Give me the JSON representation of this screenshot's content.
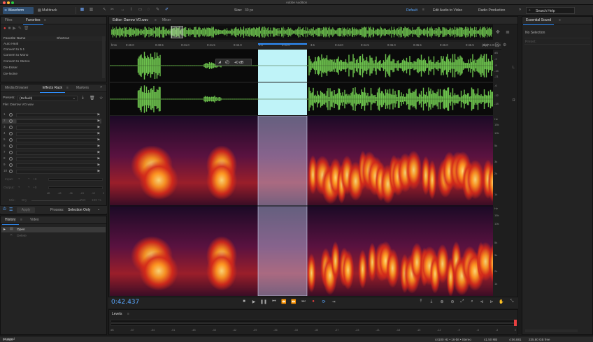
{
  "window": {
    "title": "Adobe Audition"
  },
  "toolbar": {
    "waveform": "Waveform",
    "multitrack": "Multitrack",
    "size_label": "Size:",
    "size_value": "30 px",
    "workspace_default": "Default",
    "workspace_edit_video": "Edit Audio to Video",
    "workspace_radio": "Radio Production",
    "search_placeholder": "Search Help"
  },
  "files_panel": {
    "tabs": [
      "Files",
      "Favorites"
    ],
    "columns": [
      "Favorite Name",
      "Shortcut"
    ],
    "items": [
      "Auto Heal",
      "Convert to 5.1",
      "Convert to Mono",
      "Convert to Stereo",
      "De-Esser",
      "De-Noise"
    ]
  },
  "effects_panel": {
    "tabs": [
      "Media Browser",
      "Effects Rack",
      "Markers"
    ],
    "presets_label": "Presets:",
    "presets_value": "(Default)",
    "file_label": "File: Darrow VO.wav",
    "slots": [
      "1",
      "2",
      "3",
      "4",
      "5",
      "6",
      "7",
      "8",
      "9",
      "10"
    ],
    "input_label": "Input:",
    "output_label": "Output:",
    "input_db": "+0",
    "output_db": "+0",
    "meter_ticks": [
      "dB",
      "-48",
      "-36",
      "-24",
      "-12",
      "0"
    ],
    "mix_label": "Mix:",
    "dry_label": "Dry",
    "wet_label": "Wet",
    "mix_value": "100 %",
    "apply": "Apply",
    "process_label": "Process:",
    "process_value": "Selection Only"
  },
  "history_panel": {
    "tabs": [
      "History",
      "Video"
    ],
    "items": [
      "Open",
      "Delete"
    ]
  },
  "editor": {
    "tabs": [
      "Editor: Darrow VO.wav",
      "Mixer"
    ],
    "ruler_labels": [
      "hms",
      "0:40.0",
      "0:40.5",
      "0:41.0",
      "0:41.5",
      "0:42.0",
      "2.5",
      "0:43.0",
      "3.5",
      "0:44.0",
      "0:44.5",
      "0:45.0",
      "0:45.5",
      "0:46.0",
      "0:46.5",
      "0:47.0",
      "0:47.5",
      "(clip)"
    ],
    "hud_gain": "+0 dB",
    "wave_scale": [
      "dB",
      "-3",
      "-9",
      "-15",
      "-21",
      "-6",
      "-12",
      "-18"
    ],
    "spec_scale": [
      "Hz",
      "15k",
      "10k",
      "5k",
      "3k",
      "2k",
      "1k"
    ],
    "timecode": "0:42.437"
  },
  "levels": {
    "title": "Levels",
    "ticks": [
      "dB",
      "-57",
      "-54",
      "-51",
      "-48",
      "-45",
      "-42",
      "-39",
      "-36",
      "-33",
      "-30",
      "-27",
      "-24",
      "-21",
      "-18",
      "-15",
      "-12",
      "-9",
      "-6",
      "-3",
      "0"
    ]
  },
  "essential_sound": {
    "title": "Essential Sound",
    "no_selection": "No Selection",
    "preset": "Preset:"
  },
  "status": {
    "undo": "0 Undo",
    "state": "Stopped",
    "format": "44100 Hz • 16-bit • Stereo",
    "size": "41.50 MB",
    "duration": "4:06.881",
    "free": "235.80 GB free"
  },
  "colors": {
    "accent": "#2e8fff",
    "waveform": "#6cc14d",
    "selection": "#bff3f8",
    "record": "#e84040"
  }
}
